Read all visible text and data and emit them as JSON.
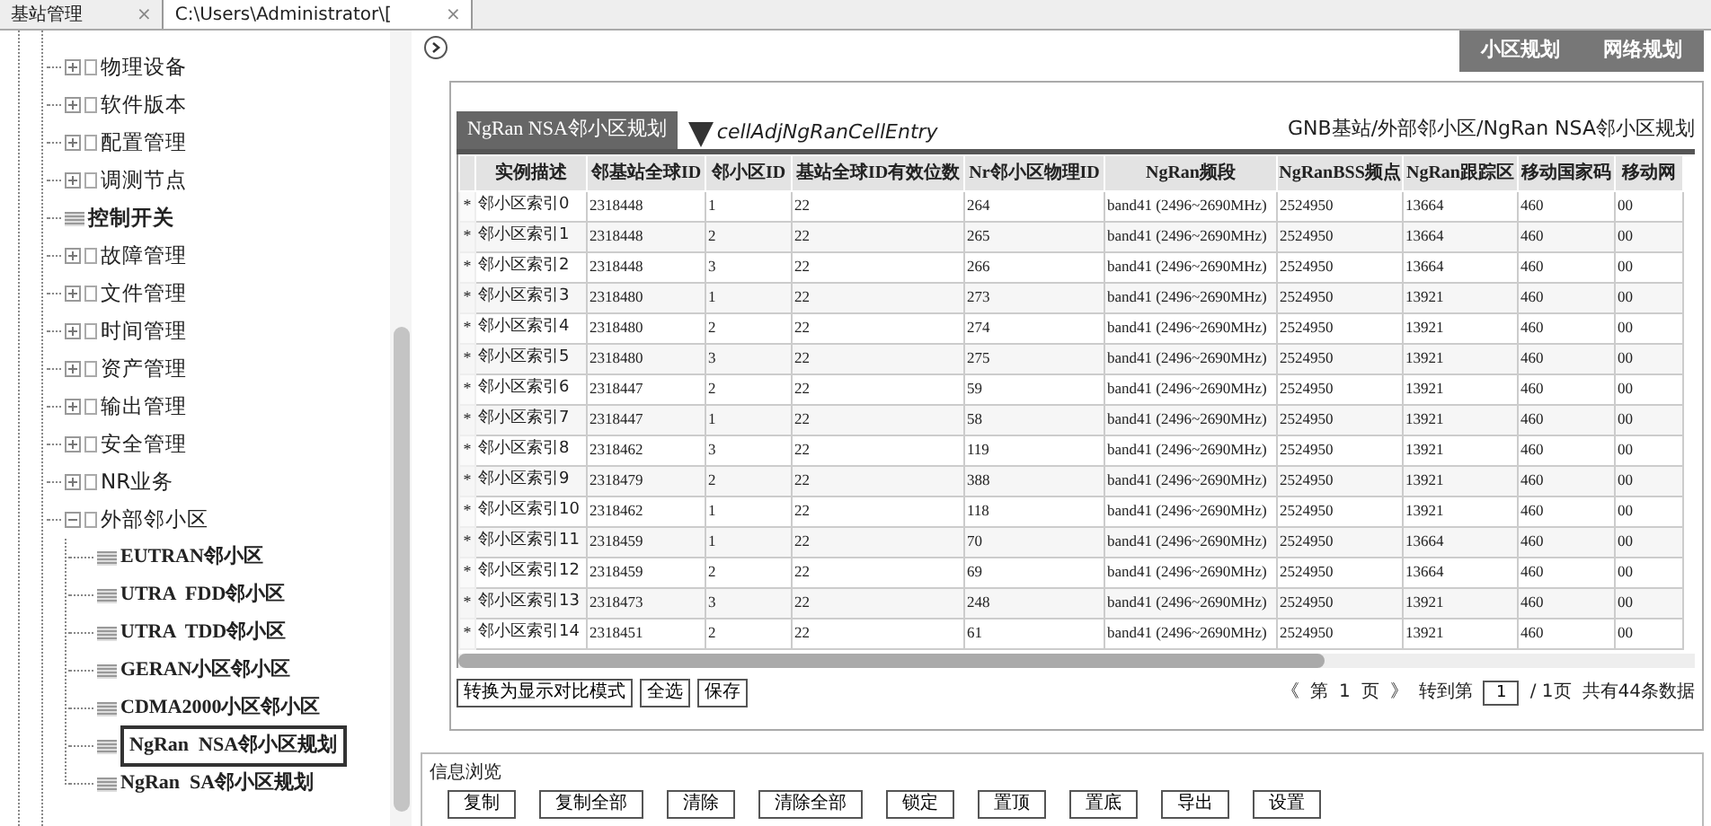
{
  "tabs": [
    {
      "label": "基站管理",
      "selected": false,
      "close": "×"
    },
    {
      "label": "C:\\Users\\Administrator\\[",
      "selected": true,
      "close": "×"
    }
  ],
  "tree": [
    {
      "kind": "folder",
      "label": "物理设备",
      "expanded": false,
      "selected": false
    },
    {
      "kind": "folder",
      "label": "软件版本",
      "expanded": false,
      "selected": false
    },
    {
      "kind": "folder",
      "label": "配置管理",
      "expanded": false,
      "selected": false
    },
    {
      "kind": "folder",
      "label": "调测节点",
      "expanded": false,
      "selected": false
    },
    {
      "kind": "leaf",
      "label": "控制开关",
      "selected": false
    },
    {
      "kind": "folder",
      "label": "故障管理",
      "expanded": false,
      "selected": false
    },
    {
      "kind": "folder",
      "label": "文件管理",
      "expanded": false,
      "selected": false
    },
    {
      "kind": "folder",
      "label": "时间管理",
      "expanded": false,
      "selected": false
    },
    {
      "kind": "folder",
      "label": "资产管理",
      "expanded": false,
      "selected": false
    },
    {
      "kind": "folder",
      "label": "输出管理",
      "expanded": false,
      "selected": false
    },
    {
      "kind": "folder",
      "label": "安全管理",
      "expanded": false,
      "selected": false
    },
    {
      "kind": "folder",
      "label": "NR业务",
      "expanded": false,
      "selected": false
    },
    {
      "kind": "folder",
      "label": "外部邻小区",
      "expanded": true,
      "selected": false,
      "children": [
        {
          "label": "EUTRAN邻小区",
          "selected": false
        },
        {
          "label": "UTRA  FDD邻小区",
          "selected": false
        },
        {
          "label": "UTRA  TDD邻小区",
          "selected": false
        },
        {
          "label": "GERAN小区邻小区",
          "selected": false
        },
        {
          "label": "CDMA2000小区邻小区",
          "selected": false
        },
        {
          "label": "NgRan  NSA邻小区规划",
          "selected": true
        },
        {
          "label": "NgRan  SA邻小区规划",
          "selected": false
        }
      ]
    }
  ],
  "top_buttons": [
    "小区规划",
    "网络规划"
  ],
  "panel": {
    "title": "NgRan NSA邻小区规划",
    "entry": "cellAdjNgRanCellEntry",
    "breadcrumb": "GNB基站/外部邻小区/NgRan NSA邻小区规划"
  },
  "table": {
    "columns": [
      "实例描述",
      "邻基站全球ID",
      "邻小区ID",
      "基站全球ID有效位数",
      "Nr邻小区物理ID",
      "NgRan频段",
      "NgRanBSS频点",
      "NgRan跟踪区",
      "移动国家码",
      "移动网"
    ],
    "rows": [
      {
        "marker": "*",
        "cells": [
          "邻小区索引0",
          "2318448",
          "1",
          "22",
          "264",
          "band41 (2496~2690MHz)",
          "2524950",
          "13664",
          "460",
          "00"
        ]
      },
      {
        "marker": "*",
        "cells": [
          "邻小区索引1",
          "2318448",
          "2",
          "22",
          "265",
          "band41 (2496~2690MHz)",
          "2524950",
          "13664",
          "460",
          "00"
        ]
      },
      {
        "marker": "*",
        "cells": [
          "邻小区索引2",
          "2318448",
          "3",
          "22",
          "266",
          "band41 (2496~2690MHz)",
          "2524950",
          "13664",
          "460",
          "00"
        ]
      },
      {
        "marker": "*",
        "cells": [
          "邻小区索引3",
          "2318480",
          "1",
          "22",
          "273",
          "band41 (2496~2690MHz)",
          "2524950",
          "13921",
          "460",
          "00"
        ]
      },
      {
        "marker": "*",
        "cells": [
          "邻小区索引4",
          "2318480",
          "2",
          "22",
          "274",
          "band41 (2496~2690MHz)",
          "2524950",
          "13921",
          "460",
          "00"
        ]
      },
      {
        "marker": "*",
        "cells": [
          "邻小区索引5",
          "2318480",
          "3",
          "22",
          "275",
          "band41 (2496~2690MHz)",
          "2524950",
          "13921",
          "460",
          "00"
        ]
      },
      {
        "marker": "*",
        "cells": [
          "邻小区索引6",
          "2318447",
          "2",
          "22",
          "59",
          "band41 (2496~2690MHz)",
          "2524950",
          "13921",
          "460",
          "00"
        ]
      },
      {
        "marker": "*",
        "cells": [
          "邻小区索引7",
          "2318447",
          "1",
          "22",
          "58",
          "band41 (2496~2690MHz)",
          "2524950",
          "13921",
          "460",
          "00"
        ]
      },
      {
        "marker": "*",
        "cells": [
          "邻小区索引8",
          "2318462",
          "3",
          "22",
          "119",
          "band41 (2496~2690MHz)",
          "2524950",
          "13921",
          "460",
          "00"
        ]
      },
      {
        "marker": "*",
        "cells": [
          "邻小区索引9",
          "2318479",
          "2",
          "22",
          "388",
          "band41 (2496~2690MHz)",
          "2524950",
          "13921",
          "460",
          "00"
        ]
      },
      {
        "marker": "*",
        "cells": [
          "邻小区索引10",
          "2318462",
          "1",
          "22",
          "118",
          "band41 (2496~2690MHz)",
          "2524950",
          "13921",
          "460",
          "00"
        ]
      },
      {
        "marker": "*",
        "cells": [
          "邻小区索引11",
          "2318459",
          "1",
          "22",
          "70",
          "band41 (2496~2690MHz)",
          "2524950",
          "13664",
          "460",
          "00"
        ]
      },
      {
        "marker": "*",
        "cells": [
          "邻小区索引12",
          "2318459",
          "2",
          "22",
          "69",
          "band41 (2496~2690MHz)",
          "2524950",
          "13664",
          "460",
          "00"
        ]
      },
      {
        "marker": "*",
        "cells": [
          "邻小区索引13",
          "2318473",
          "3",
          "22",
          "248",
          "band41 (2496~2690MHz)",
          "2524950",
          "13921",
          "460",
          "00"
        ]
      },
      {
        "marker": "*",
        "cells": [
          "邻小区索引14",
          "2318451",
          "2",
          "22",
          "61",
          "band41 (2496~2690MHz)",
          "2524950",
          "13921",
          "460",
          "00"
        ]
      }
    ]
  },
  "table_buttons": [
    "转换为显示对比模式",
    "全选",
    "保存"
  ],
  "pager": {
    "prev": "《",
    "page_label": "第",
    "page": "1",
    "page_unit": "页",
    "next": "》",
    "goto_label": "转到第",
    "goto_value": "1",
    "total_pages": "/ 1页",
    "total": "共有44条数据"
  },
  "info": {
    "title": "信息浏览",
    "buttons": [
      "复制",
      "复制全部",
      "清除",
      "清除全部",
      "锁定",
      "置顶",
      "置底",
      "导出",
      "设置"
    ]
  }
}
